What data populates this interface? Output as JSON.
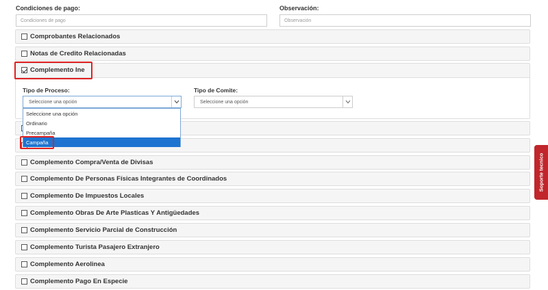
{
  "form": {
    "payment_conditions_label": "Condiciones de pago:",
    "payment_conditions_placeholder": "Condiciones de pago",
    "observation_label": "Observación:",
    "observation_placeholder": "Observación"
  },
  "panels": {
    "p1": "Comprobantes Relacionados",
    "p2": "Notas de Credito Relacionadas",
    "p3": "Complemento Ine",
    "p6": "Complemento Compra/Venta de Divisas",
    "p7": "Complemento De Personas Físicas Integrantes de Coordinados",
    "p8": "Complemento De Impuestos Locales",
    "p9": "Complemento Obras De Arte Plasticas Y Antigüedades",
    "p10": "Complemento Servicio Parcial de Construcción",
    "p11": "Complemento Turista Pasajero Extranjero",
    "p12": "Complemento Aerolinea",
    "p13": "Complemento Pago En Especie"
  },
  "ine": {
    "process_type_label": "Tipo de Proceso:",
    "process_type_value": "Seleccione una opción",
    "committee_type_label": "Tipo de Comite:",
    "committee_type_value": "Seleccione una opción",
    "options": [
      "Seleccione una opción",
      "Ordinario",
      "Precampaña",
      "Campaña"
    ],
    "highlighted_option": "Campaña"
  },
  "support": {
    "label": "Soporte tecnico"
  },
  "colors": {
    "highlight": "#e02020",
    "selected_option": "#1e74d0",
    "support_tab": "#c0262c"
  }
}
